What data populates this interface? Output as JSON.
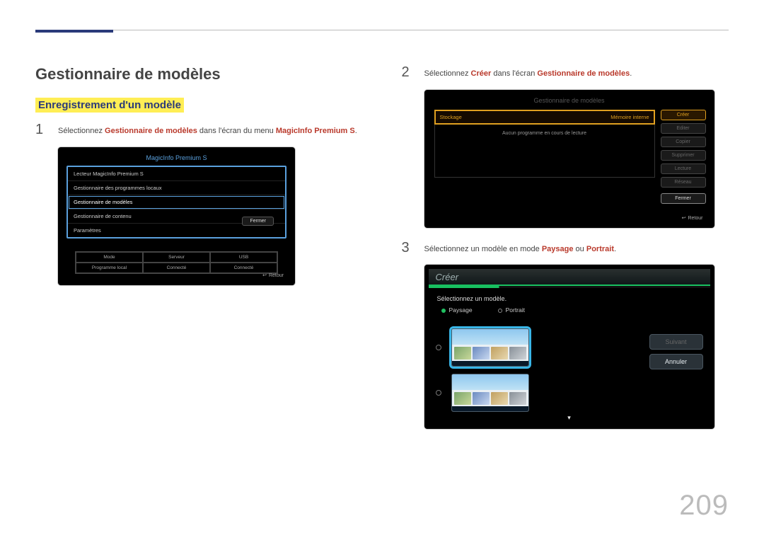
{
  "page_number": "209",
  "title": "Gestionnaire de modèles",
  "subheading": "Enregistrement d'un modèle",
  "steps": {
    "s1": {
      "num": "1",
      "pre": "Sélectionnez ",
      "hl1": "Gestionnaire de modèles",
      "mid": " dans l'écran du menu ",
      "hl2": "MagicInfo Premium S",
      "post": "."
    },
    "s2": {
      "num": "2",
      "pre": "Sélectionnez ",
      "hl1": "Créer",
      "mid": " dans l'écran ",
      "hl2": "Gestionnaire de modèles",
      "post": "."
    },
    "s3": {
      "num": "3",
      "pre": "Sélectionnez un modèle en mode ",
      "hl1": "Paysage",
      "mid": " ou ",
      "hl2": "Portrait",
      "post": "."
    }
  },
  "shot1": {
    "title": "MagicInfo Premium S",
    "items": [
      "Lecteur MagicInfo Premium S",
      "Gestionnaire des programmes locaux",
      "Gestionnaire de modèles",
      "Gestionnaire de contenu",
      "Paramètres"
    ],
    "close": "Fermer",
    "grid": [
      "Mode",
      "Serveur",
      "USB",
      "Programme local",
      "Connecté",
      "Connecté"
    ],
    "return": "Retour"
  },
  "shot2": {
    "title": "Gestionnaire de modèles",
    "tab_left": "Stockage",
    "tab_right": "Mémoire interne",
    "empty": "Aucun programme en cours de lecture",
    "buttons": [
      "Créer",
      "Editer",
      "Copier",
      "Supprimer",
      "Lecture",
      "Réseau"
    ],
    "close": "Fermer",
    "return": "Retour"
  },
  "shot3": {
    "header": "Créer",
    "sub": "Sélectionnez un modèle.",
    "opt1": "Paysage",
    "opt2": "Portrait",
    "next": "Suivant",
    "cancel": "Annuler"
  }
}
